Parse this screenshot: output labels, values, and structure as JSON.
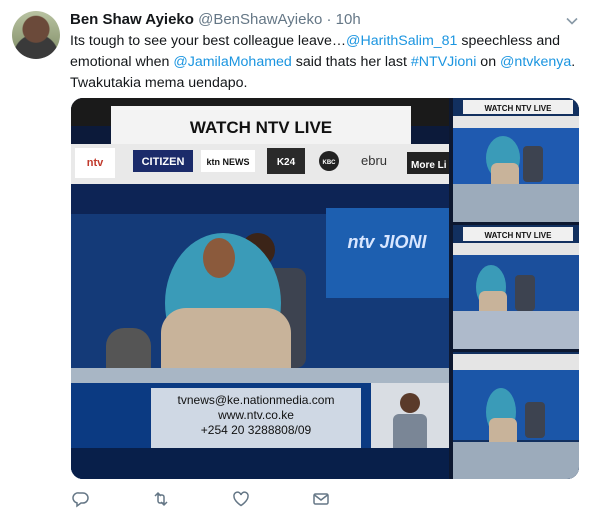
{
  "tweet": {
    "display_name": "Ben Shaw Ayieko",
    "handle": "@BenShawAyieko",
    "separator": "·",
    "timestamp": "10h",
    "text_parts": [
      "Its tough to see your best colleague leave…",
      "@HarithSalim_81",
      " speechless and emotional when ",
      "@JamilaMohamed",
      " said thats her last ",
      "#NTVJioni",
      " on ",
      "@ntvkenya",
      ". Twakutakia mema uendapo."
    ]
  },
  "media": {
    "main_banner": "WATCH NTV LIVE",
    "thumb_banner": "WATCH NTV LIVE",
    "channel_logos": [
      "ntv",
      "CITIZEN",
      "ktn NEWS",
      "K24",
      "KBC",
      "ebru",
      "More Li"
    ],
    "show_logo": "ntv JIONI",
    "ticker_lines": [
      "tvnews@ke.nationmedia.com",
      "www.ntv.co.ke",
      "+254 20 3288808/09"
    ]
  },
  "actions": {
    "icons": [
      "reply-icon",
      "retweet-icon",
      "like-icon",
      "message-icon"
    ]
  },
  "colors": {
    "link": "#1b95e0",
    "text": "#14171a",
    "muted": "#657786",
    "hijab": "#3a9bb8"
  }
}
